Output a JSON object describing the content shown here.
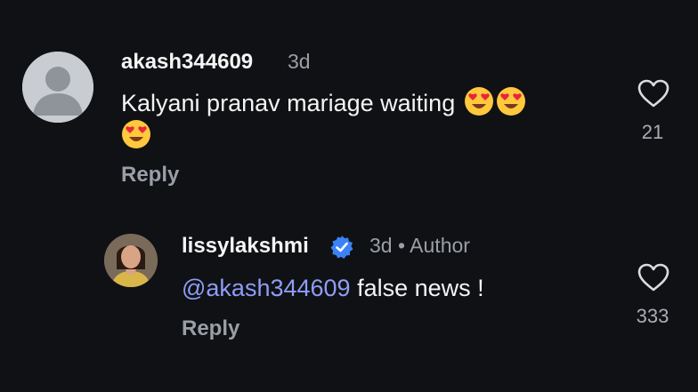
{
  "comments": [
    {
      "username": "akash344609",
      "time": "3d",
      "text": "Kalyani pranav mariage waiting",
      "emojis": [
        "heart-eyes-emoji",
        "heart-eyes-emoji",
        "heart-eyes-emoji"
      ],
      "reply_label": "Reply",
      "likes": "21",
      "avatar_icon": "default-user-avatar"
    },
    {
      "username": "lissylakshmi",
      "verified": true,
      "time": "3d",
      "separator": "•",
      "author_label": "Author",
      "mention": "@akash344609",
      "text": " false news !",
      "reply_label": "Reply",
      "likes": "333",
      "avatar_icon": "profile-photo-avatar"
    }
  ],
  "colors": {
    "background": "#101114",
    "mention": "#8e9df7",
    "secondary_text": "#9a9ea6",
    "verified_badge": "#3b82f6"
  }
}
